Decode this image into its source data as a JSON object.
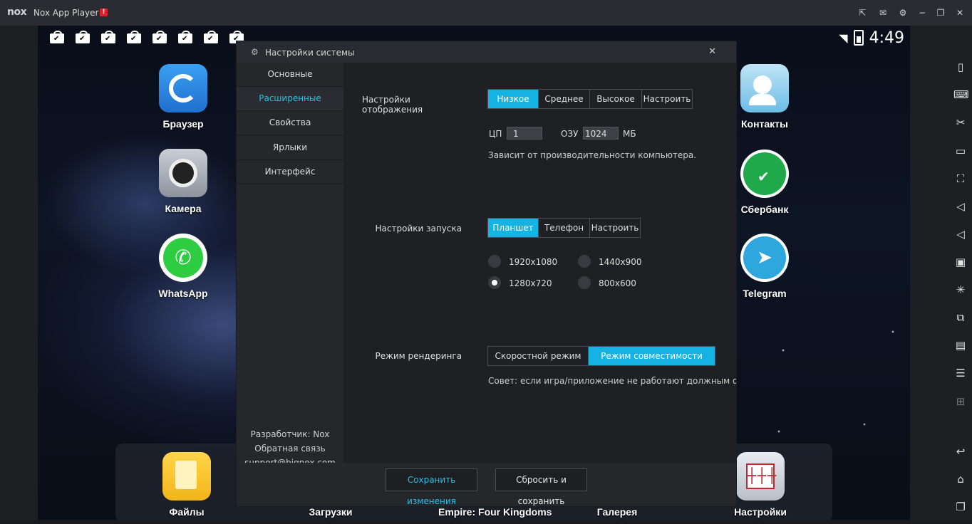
{
  "window": {
    "logo": "nox",
    "title": "Nox App Player",
    "warning": "!",
    "controls": [
      "pin-icon",
      "mail-icon",
      "gear-icon",
      "minimize-icon",
      "restore-icon",
      "close-icon"
    ]
  },
  "status_bar": {
    "time": "4:49"
  },
  "desktop": {
    "left_apps": [
      {
        "label": "Браузер",
        "icon": "browser-icon"
      },
      {
        "label": "Камера",
        "icon": "camera-icon"
      },
      {
        "label": "WhatsApp",
        "icon": "whatsapp-icon"
      }
    ],
    "right_apps": [
      {
        "label": "Контакты",
        "icon": "contacts-icon"
      },
      {
        "label": "Сбербанк",
        "icon": "sberbank-icon"
      },
      {
        "label": "Telegram",
        "icon": "telegram-icon"
      }
    ],
    "dock": [
      {
        "label": "Файлы",
        "icon": "files-icon"
      },
      {
        "label": "Загрузки",
        "icon": "downloads-icon"
      },
      {
        "label": "Empire: Four Kingdoms",
        "icon": "game-icon"
      },
      {
        "label": "Галерея",
        "icon": "gallery-icon"
      },
      {
        "label": "Настройки",
        "icon": "settings-icon"
      }
    ]
  },
  "dialog": {
    "title": "Настройки системы",
    "tabs": [
      "Основные",
      "Расширенные",
      "Свойства",
      "Ярлыки",
      "Интерфейс"
    ],
    "active_tab": "Расширенные",
    "developer": "Разработчик: Nox",
    "feedback": "Обратная связь",
    "email": "support@bignox.com",
    "display": {
      "label": "Настройки отображения",
      "options": [
        "Низкое",
        "Среднее",
        "Высокое",
        "Настроить"
      ],
      "selected": "Низкое",
      "cpu_label": "ЦП",
      "cpu_value": "1",
      "ram_label": "ОЗУ",
      "ram_value": "1024",
      "ram_unit": "МБ",
      "note": "Зависит от производительности компьютера."
    },
    "startup": {
      "label": "Настройки запуска",
      "options": [
        "Планшет",
        "Телефон",
        "Настроить"
      ],
      "selected": "Планшет",
      "resolutions": [
        "1920x1080",
        "1440x900",
        "1280x720",
        "800x600"
      ],
      "selected_resolution": "1280x720"
    },
    "render": {
      "label": "Режим рендеринга",
      "options": [
        "Скоростной режим",
        "Режим совместимости"
      ],
      "selected": "Режим совместимости",
      "tip": "Совет: если игра/приложение не работают должным образом"
    },
    "save_button": "Сохранить изменения",
    "reset_button": "Сбросить и сохранить"
  },
  "toolbar": [
    "shake-icon",
    "keyboard-icon",
    "scissors-icon",
    "screen-icon",
    "fullscreen-icon",
    "volume-up-icon",
    "volume-down-icon",
    "apk-icon",
    "loading-icon",
    "multi-instance-icon",
    "macro-icon",
    "record-icon",
    "add-icon",
    "back-icon",
    "home-icon",
    "recent-apps-icon"
  ],
  "colors": {
    "accent": "#14b3e1",
    "active_tab": "#27c0e6"
  }
}
